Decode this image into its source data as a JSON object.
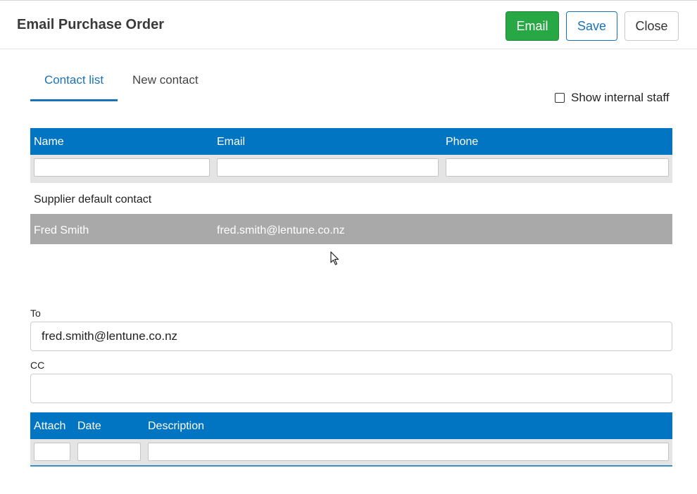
{
  "dialog": {
    "title": "Email Purchase Order",
    "buttons": {
      "email": "Email",
      "save": "Save",
      "close": "Close"
    }
  },
  "tabs": [
    {
      "label": "Contact list",
      "active": true
    },
    {
      "label": "New contact",
      "active": false
    }
  ],
  "show_internal_staff": {
    "label": "Show internal staff",
    "checked": false
  },
  "contact_grid": {
    "columns": [
      "Name",
      "Email",
      "Phone"
    ],
    "group_label": "Supplier default contact",
    "rows": [
      {
        "name": "Fred Smith",
        "email": "fred.smith@lentune.co.nz",
        "phone": "",
        "selected": true
      }
    ]
  },
  "to_field": {
    "label": "To",
    "value": "fred.smith@lentune.co.nz"
  },
  "cc_field": {
    "label": "CC",
    "value": ""
  },
  "attachments_grid": {
    "columns": [
      "Attach",
      "Date",
      "Description"
    ]
  },
  "colors": {
    "accent": "#0275c2",
    "email_button": "#28a745",
    "selected_row": "#a9a9a9"
  }
}
